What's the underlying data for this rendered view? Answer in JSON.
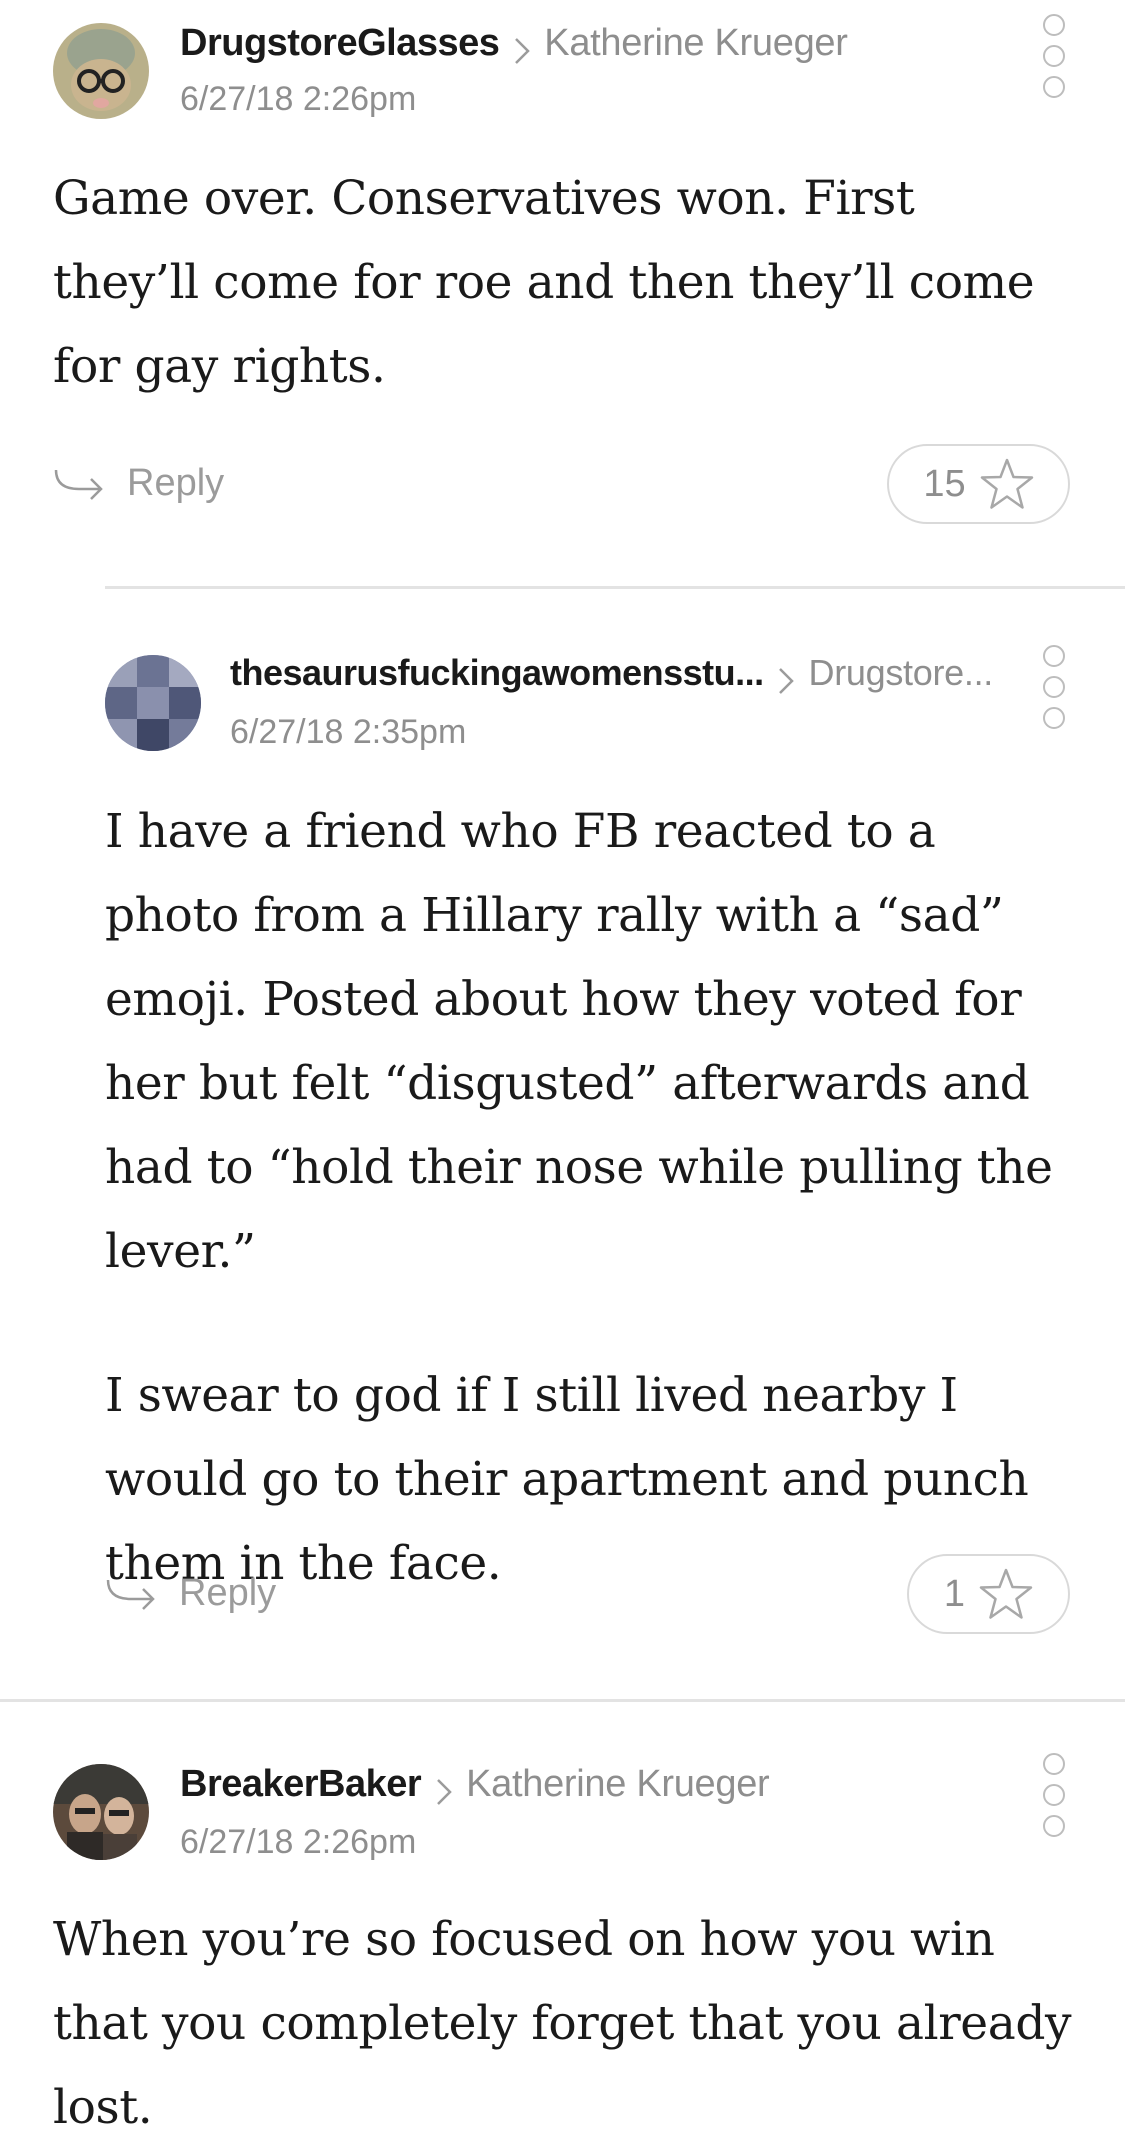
{
  "comments": [
    {
      "author": "DrugstoreGlasses",
      "reply_to": "Katherine Krueger",
      "timestamp": "6/27/18 2:26pm",
      "paragraphs": [
        "Game over. Conservatives won. First they’ll come for roe and then they’ll come for gay rights."
      ],
      "reply_label": "Reply",
      "stars": "15"
    },
    {
      "author": "thesaurusfuckingawomensstu...",
      "reply_to": "Drugstore...",
      "timestamp": "6/27/18 2:35pm",
      "paragraphs": [
        "I have a friend who FB reacted to a photo from a Hillary rally with a “sad” emoji. Posted about how they voted for her but felt “disgusted” afterwards and had to “hold their nose while pulling the lever.”",
        "I swear to god if I still lived nearby I would go to their apartment and punch them in the face."
      ],
      "reply_label": "Reply",
      "stars": "1"
    },
    {
      "author": "BreakerBaker",
      "reply_to": "Katherine Krueger",
      "timestamp": "6/27/18 2:26pm",
      "paragraphs": [
        "When you’re so focused on how you win that you completely forget that you already lost."
      ]
    }
  ],
  "icons": {
    "chevron": "chevron-right-icon",
    "reply": "reply-arrow-icon",
    "star": "star-outline-icon",
    "more": "more-options-icon"
  }
}
